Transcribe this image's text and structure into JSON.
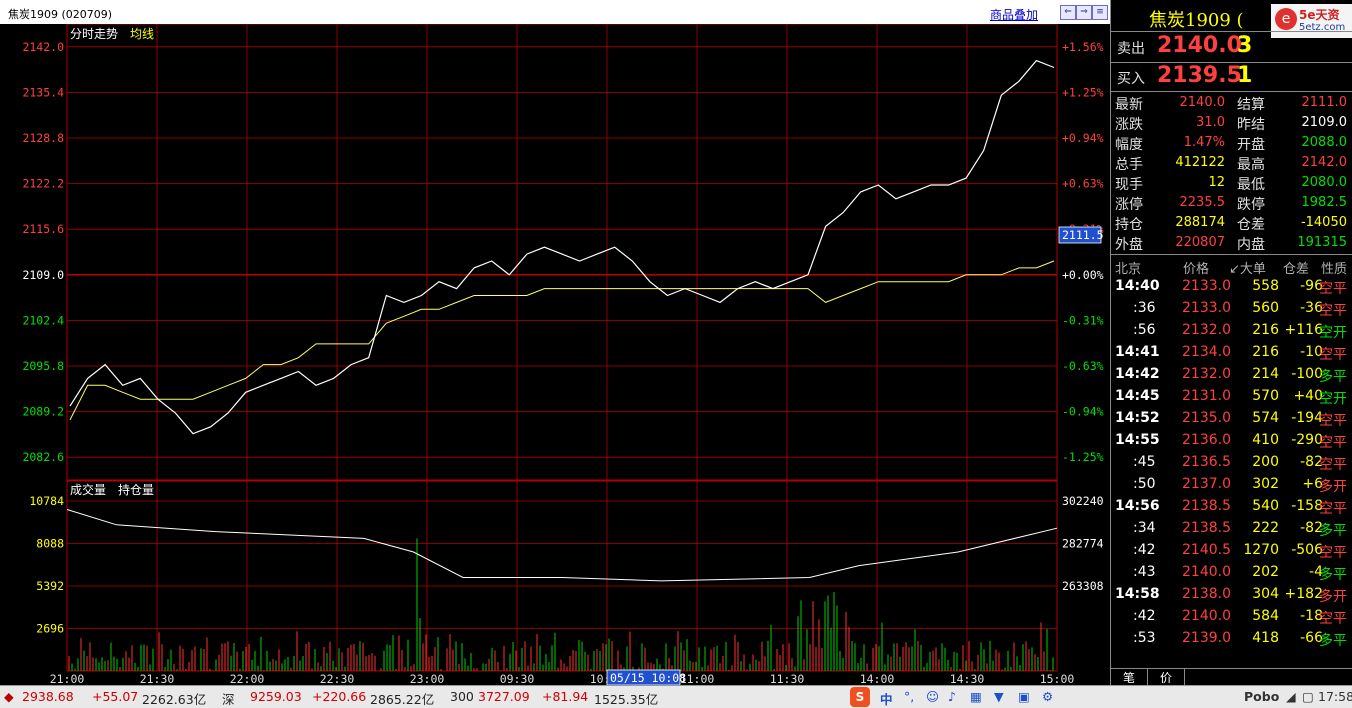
{
  "window": {
    "title": "焦炭1909 (020709)",
    "overlay_link": "商品叠加",
    "panel_title": "焦炭1909 (",
    "logo_text": "5e天资",
    "logo_url": "5etz.com"
  },
  "chart": {
    "labels": {
      "intraday": "分时走势",
      "avg_line": "均线",
      "volume": "成交量",
      "open_interest": "持仓量"
    },
    "price_axis": [
      "2142.0",
      "2135.4",
      "2128.8",
      "2122.2",
      "2115.6",
      "2109.0",
      "2102.4",
      "2095.8",
      "2089.2",
      "2082.6"
    ],
    "pct_axis": [
      "+1.56%",
      "+1.25%",
      "+0.94%",
      "+0.63%",
      "+0.31%",
      "+0.00%",
      "-0.31%",
      "-0.63%",
      "-0.94%",
      "-1.25%"
    ],
    "current_marker": "2111.5",
    "volume_axis": [
      "10784",
      "8088",
      "5392",
      "2696"
    ],
    "oi_axis": [
      "302240",
      "282774",
      "263308"
    ],
    "time_axis": [
      "21:00",
      "21:30",
      "22:00",
      "22:30",
      "23:00",
      "09:30",
      "10:00",
      "11:00",
      "11:30",
      "14:00",
      "14:30",
      "15:00"
    ],
    "cursor_time": "05/15 10:08"
  },
  "chart_data": {
    "type": "line",
    "title": "焦炭1909 (020709)",
    "ylim": [
      2079.3,
      2145.3
    ],
    "reference_price": 2109.0,
    "series": [
      {
        "name": "价格",
        "values": [
          2090,
          2094,
          2096,
          2093,
          2094,
          2091,
          2089,
          2086,
          2087,
          2089,
          2092,
          2093,
          2094,
          2095,
          2093,
          2094,
          2096,
          2097,
          2106,
          2105,
          2106,
          2108,
          2107,
          2110,
          2111,
          2109,
          2112,
          2113,
          2112,
          2111,
          2112,
          2113,
          2111,
          2108,
          2106,
          2107,
          2106,
          2105,
          2107,
          2108,
          2107,
          2108,
          2109,
          2116,
          2118,
          2121,
          2122,
          2120,
          2121,
          2122,
          2122,
          2123,
          2127,
          2135,
          2137,
          2140,
          2139
        ]
      },
      {
        "name": "均线",
        "values": [
          2088,
          2093,
          2093,
          2092,
          2091,
          2091,
          2091,
          2091,
          2092,
          2093,
          2094,
          2096,
          2096,
          2097,
          2099,
          2099,
          2099,
          2099,
          2102,
          2103,
          2104,
          2104,
          2105,
          2106,
          2106,
          2106,
          2106,
          2107,
          2107,
          2107,
          2107,
          2107,
          2107,
          2107,
          2107,
          2107,
          2107,
          2107,
          2107,
          2107,
          2107,
          2107,
          2107,
          2105,
          2106,
          2107,
          2108,
          2108,
          2108,
          2108,
          2108,
          2109,
          2109,
          2109,
          2110,
          2110,
          2111
        ]
      }
    ]
  },
  "quote": {
    "sell": {
      "label": "卖出",
      "price": "2140.0",
      "qty": "3"
    },
    "buy": {
      "label": "买入",
      "price": "2139.5",
      "qty": "1"
    },
    "rows": [
      {
        "l1": "最新",
        "v1": "2140.0",
        "c1": "red",
        "l2": "结算",
        "v2": "2111.0",
        "c2": "red"
      },
      {
        "l1": "涨跌",
        "v1": "31.0",
        "c1": "red",
        "l2": "昨结",
        "v2": "2109.0",
        "c2": "white"
      },
      {
        "l1": "幅度",
        "v1": "1.47%",
        "c1": "red",
        "l2": "开盘",
        "v2": "2088.0",
        "c2": "green"
      },
      {
        "l1": "总手",
        "v1": "412122",
        "c1": "yellow",
        "l2": "最高",
        "v2": "2142.0",
        "c2": "red"
      },
      {
        "l1": "现手",
        "v1": "12",
        "c1": "yellow",
        "l2": "最低",
        "v2": "2080.0",
        "c2": "green"
      },
      {
        "l1": "涨停",
        "v1": "2235.5",
        "c1": "red",
        "l2": "跌停",
        "v2": "1982.5",
        "c2": "green"
      },
      {
        "l1": "持仓",
        "v1": "288174",
        "c1": "yellow",
        "l2": "仓差",
        "v2": "-14050",
        "c2": "yellow"
      },
      {
        "l1": "外盘",
        "v1": "220807",
        "c1": "red",
        "l2": "内盘",
        "v2": "191315",
        "c2": "green"
      }
    ]
  },
  "ticks": {
    "headers": [
      "北京",
      "价格",
      "↙大单",
      "仓差",
      "性质"
    ],
    "rows": [
      {
        "t": "14:40",
        "p": "2133.0",
        "v": "558",
        "d": "-96",
        "n": "空平",
        "nc": "red"
      },
      {
        "t": ":36",
        "p": "2133.0",
        "v": "560",
        "d": "-36",
        "n": "空平",
        "nc": "red"
      },
      {
        "t": ":56",
        "p": "2132.0",
        "v": "216",
        "d": "+116",
        "n": "空开",
        "nc": "green"
      },
      {
        "t": "14:41",
        "p": "2134.0",
        "v": "216",
        "d": "-10",
        "n": "空平",
        "nc": "red"
      },
      {
        "t": "14:42",
        "p": "2132.0",
        "v": "214",
        "d": "-100",
        "n": "多平",
        "nc": "green"
      },
      {
        "t": "14:45",
        "p": "2131.0",
        "v": "570",
        "d": "+40",
        "n": "空开",
        "nc": "green"
      },
      {
        "t": "14:52",
        "p": "2135.0",
        "v": "574",
        "d": "-194",
        "n": "空平",
        "nc": "red"
      },
      {
        "t": "14:55",
        "p": "2136.0",
        "v": "410",
        "d": "-290",
        "n": "空平",
        "nc": "red"
      },
      {
        "t": ":45",
        "p": "2136.5",
        "v": "200",
        "d": "-82",
        "n": "空平",
        "nc": "red"
      },
      {
        "t": ":50",
        "p": "2137.0",
        "v": "302",
        "d": "+6",
        "n": "多开",
        "nc": "red"
      },
      {
        "t": "14:56",
        "p": "2138.5",
        "v": "540",
        "d": "-158",
        "n": "空平",
        "nc": "red"
      },
      {
        "t": ":34",
        "p": "2138.5",
        "v": "222",
        "d": "-82",
        "n": "多平",
        "nc": "green"
      },
      {
        "t": ":42",
        "p": "2140.5",
        "v": "1270",
        "d": "-506",
        "n": "空平",
        "nc": "red"
      },
      {
        "t": ":43",
        "p": "2140.0",
        "v": "202",
        "d": "-4",
        "n": "多平",
        "nc": "green"
      },
      {
        "t": "14:58",
        "p": "2138.0",
        "v": "304",
        "d": "+182",
        "n": "多开",
        "nc": "red"
      },
      {
        "t": ":42",
        "p": "2140.0",
        "v": "584",
        "d": "-18",
        "n": "空平",
        "nc": "red"
      },
      {
        "t": ":53",
        "p": "2139.0",
        "v": "418",
        "d": "-66",
        "n": "多平",
        "nc": "green"
      }
    ],
    "tabs": [
      "笔",
      "价"
    ]
  },
  "status": {
    "idx1_val": "2938.68",
    "idx1_chg": "+55.07",
    "idx1_amt": "2262.63亿",
    "idx2_name": "深",
    "idx2_val": "9259.03",
    "idx2_chg": "+220.66",
    "idx2_amt": "2865.22亿",
    "idx3_name": "300",
    "idx3_val": "3727.09",
    "idx3_chg": "+81.94",
    "idx3_amt": "1525.35亿",
    "ime": "中",
    "brand": "Pobo",
    "clock": "17:58"
  }
}
